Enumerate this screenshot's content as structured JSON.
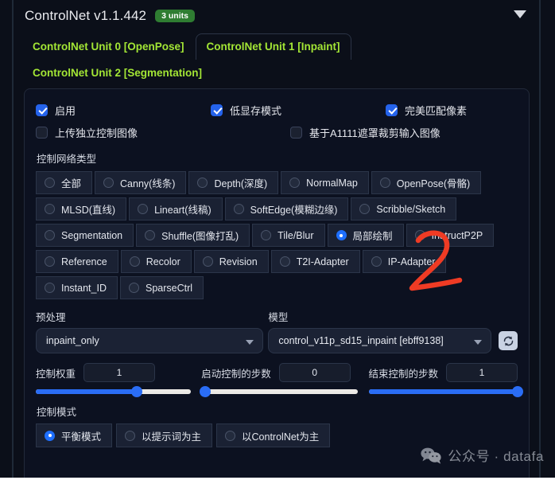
{
  "accordion": {
    "title": "ControlNet v1.1.442",
    "units_badge": "3 units",
    "caret_icon": "chevron-down-icon"
  },
  "tabs": [
    {
      "label": "ControlNet Unit 0 [OpenPose]",
      "active": false
    },
    {
      "label": "ControlNet Unit 1 [Inpaint]",
      "active": true
    },
    {
      "label": "ControlNet Unit 2 [Segmentation]",
      "active": false
    }
  ],
  "checkboxes": [
    {
      "label": "启用",
      "checked": true
    },
    {
      "label": "低显存模式",
      "checked": true
    },
    {
      "label": "完美匹配像素",
      "checked": true
    },
    {
      "label": "上传独立控制图像",
      "checked": false
    },
    {
      "label": "基于A1111遮罩裁剪输入图像",
      "checked": false
    }
  ],
  "control_type": {
    "label": "控制网络类型",
    "options": [
      "全部",
      "Canny(线条)",
      "Depth(深度)",
      "NormalMap",
      "OpenPose(骨骼)",
      "MLSD(直线)",
      "Lineart(线稿)",
      "SoftEdge(模糊边缘)",
      "Scribble/Sketch",
      "Segmentation",
      "Shuffle(图像打乱)",
      "Tile/Blur",
      "局部绘制",
      "InstructP2P",
      "Reference",
      "Recolor",
      "Revision",
      "T2I-Adapter",
      "IP-Adapter",
      "Instant_ID",
      "SparseCtrl"
    ],
    "selected": "局部绘制"
  },
  "preprocessor": {
    "label": "预处理",
    "value": "inpaint_only",
    "caret_icon": "chevron-down-icon"
  },
  "model": {
    "label": "模型",
    "value": "control_v11p_sd15_inpaint [ebff9138]",
    "caret_icon": "chevron-down-icon",
    "refresh_icon": "refresh-icon"
  },
  "sliders": [
    {
      "label": "控制权重",
      "value": "1",
      "percent": 65
    },
    {
      "label": "启动控制的步数",
      "value": "0",
      "percent": 2
    },
    {
      "label": "结束控制的步数",
      "value": "1",
      "percent": 100
    }
  ],
  "control_mode": {
    "label": "控制模式",
    "options": [
      {
        "label": "平衡模式",
        "selected": true
      },
      {
        "label": "以提示词为主",
        "selected": false
      },
      {
        "label": "以ControlNet为主",
        "selected": false
      }
    ]
  },
  "annotation": {
    "text": "2",
    "color": "#ef3b24"
  },
  "watermark": {
    "icon": "wechat-icon",
    "text": "公众号 · datafa"
  },
  "colors": {
    "background": "#0b0f19",
    "tab_text": "#a3e635",
    "badge_green": "#2f7d32",
    "accent_blue": "#2563eb",
    "slider_blue": "#2a6df5"
  }
}
